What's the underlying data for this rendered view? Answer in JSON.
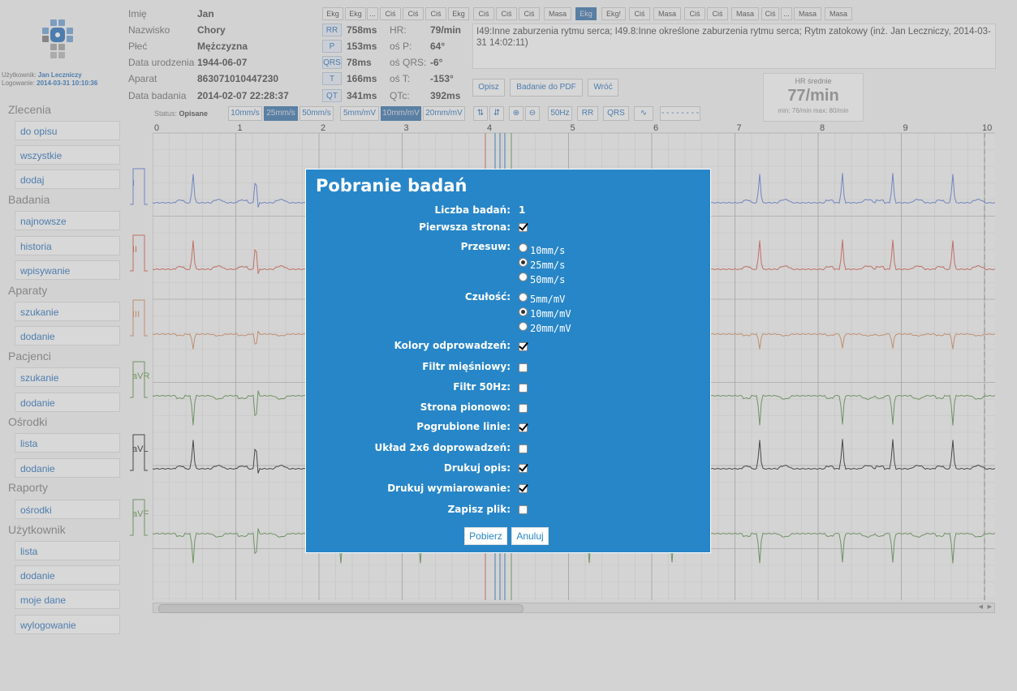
{
  "sidebar": {
    "user_label": "Użytkownik:",
    "user_name": "Jan Leczniczy",
    "login_label": "Logowanie:",
    "login_time": "2014-03-31 10:10:36",
    "sections": [
      {
        "title": "Zlecenia",
        "items": [
          "do opisu",
          "wszystkie",
          "dodaj"
        ]
      },
      {
        "title": "Badania",
        "items": [
          "najnowsze",
          "historia",
          "wpisywanie"
        ]
      },
      {
        "title": "Aparaty",
        "items": [
          "szukanie",
          "dodanie"
        ]
      },
      {
        "title": "Pacjenci",
        "items": [
          "szukanie",
          "dodanie"
        ]
      },
      {
        "title": "Ośrodki",
        "items": [
          "lista",
          "dodanie"
        ]
      },
      {
        "title": "Raporty",
        "items": [
          "ośrodki"
        ]
      },
      {
        "title": "Użytkownik",
        "items": [
          "lista",
          "dodanie",
          "moje dane",
          "wylogowanie"
        ]
      }
    ]
  },
  "patient": {
    "first_name_label": "Imię",
    "first_name": "Jan",
    "last_name_label": "Nazwisko",
    "last_name": "Chory",
    "sex_label": "Płeć",
    "sex": "Mężczyzna",
    "birth_label": "Data urodzenia",
    "birth": "1944-06-07",
    "device_label": "Aparat",
    "device": "863071010447230",
    "exam_label": "Data badania",
    "exam": "2014-02-07 22:28:37"
  },
  "measures": {
    "rr_tag": "RR",
    "rr": "758ms",
    "hr_label": "HR:",
    "hr": "79/min",
    "p_tag": "P",
    "p": "153ms",
    "osp_label": "oś P:",
    "osp": "64°",
    "qrs_tag": "QRS",
    "qrs": "78ms",
    "osqrs_label": "oś QRS:",
    "osqrs": "-6°",
    "t_tag": "T",
    "t": "166ms",
    "ost_label": "oś T:",
    "ost": "-153°",
    "qt_tag": "QT",
    "qt": "341ms",
    "qtc_label": "QTc:",
    "qtc": "392ms"
  },
  "tabs": [
    "Ekg",
    "Ekg",
    "...",
    "Ciś",
    "Ciś",
    "Ciś",
    "Ekg",
    "Ciś",
    "Ciś",
    "Ciś",
    "Masa",
    "Ekg",
    "Ekg!",
    "Ciś",
    "Masa",
    "Ciś",
    "Ciś",
    "Masa",
    "Ciś",
    "...",
    "Masa",
    "Masa"
  ],
  "diagnosis": "I49:Inne zaburzenia rytmu serca; I49.8:Inne określone zaburzenia rytmu serca; Rytm zatokowy (inż. Jan Leczniczy, 2014-03-31 14:02:11)",
  "actions": {
    "describe": "Opisz",
    "to_pdf": "Badanie do PDF",
    "back": "Wróć"
  },
  "hr_box": {
    "title": "HR średnie",
    "value": "77/min",
    "minmax": "min: 76/min  max: 80/min"
  },
  "toolbar": {
    "status_label": "Status:",
    "status": "Opisane",
    "speeds": [
      "10mm/s",
      "25mm/s",
      "50mm/s"
    ],
    "gains": [
      "5mm/mV",
      "10mm/mV",
      "20mm/mV"
    ],
    "filter": "50Hz",
    "rr": "RR",
    "qrs": "QRS",
    "dashes": "- - - - - - - -"
  },
  "ecg": {
    "time_ticks": [
      "0",
      "1",
      "2",
      "3",
      "4",
      "5",
      "6",
      "7",
      "8",
      "9",
      "10"
    ],
    "leads": [
      {
        "name": "I",
        "color": "#6a88d8"
      },
      {
        "name": "II",
        "color": "#d86a5a"
      },
      {
        "name": "III",
        "color": "#d8956a"
      },
      {
        "name": "aVR",
        "color": "#6a9a5a"
      },
      {
        "name": "aVL",
        "color": "#333333"
      },
      {
        "name": "aVF",
        "color": "#6a9a5a"
      }
    ]
  },
  "modal": {
    "title": "Pobranie badań",
    "count_label": "Liczba badań:",
    "count": "1",
    "first_page_label": "Pierwsza strona:",
    "speed_label": "Przesuw:",
    "speed_options": [
      "10mm/s",
      "25mm/s",
      "50mm/s"
    ],
    "gain_label": "Czułość:",
    "gain_options": [
      "5mm/mV",
      "10mm/mV",
      "20mm/mV"
    ],
    "lead_colors_label": "Kolory odprowadzeń:",
    "muscle_filter_label": "Filtr mięśniowy:",
    "filter50_label": "Filtr 50Hz:",
    "portrait_label": "Strona pionowo:",
    "thick_lines_label": "Pogrubione linie:",
    "layout_label": "Układ 2x6 doprowadzeń:",
    "print_desc_label": "Drukuj opis:",
    "print_dims_label": "Drukuj wymiarowanie:",
    "save_file_label": "Zapisz plik:",
    "download": "Pobierz",
    "cancel": "Anuluj"
  }
}
